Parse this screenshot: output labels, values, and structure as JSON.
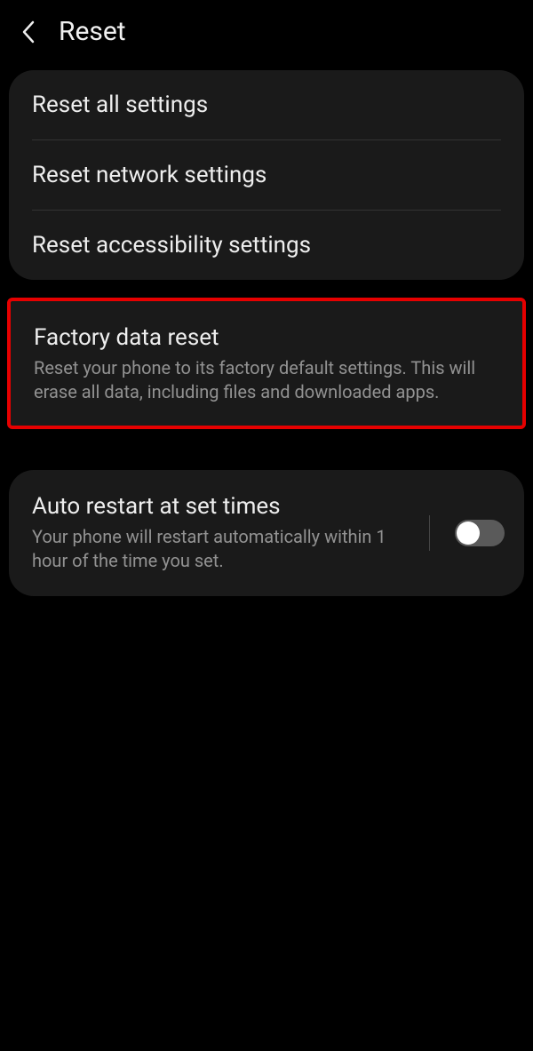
{
  "header": {
    "title": "Reset"
  },
  "group1": {
    "items": [
      {
        "title": "Reset all settings"
      },
      {
        "title": "Reset network settings"
      },
      {
        "title": "Reset accessibility settings"
      }
    ]
  },
  "factory": {
    "title": "Factory data reset",
    "description": "Reset your phone to its factory default settings. This will erase all data, including files and downloaded apps."
  },
  "autorestart": {
    "title": "Auto restart at set times",
    "description": "Your phone will restart automatically within 1 hour of the time you set.",
    "enabled": false
  }
}
